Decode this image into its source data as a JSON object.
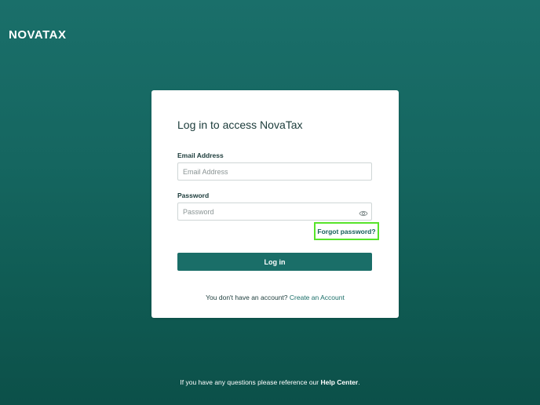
{
  "brand": {
    "logo_text": "NOVATAX"
  },
  "login": {
    "title": "Log in to access NovaTax",
    "email_label": "Email Address",
    "email_placeholder": "Email Address",
    "email_value": "",
    "password_label": "Password",
    "password_placeholder": "Password",
    "password_value": "",
    "forgot_link": "Forgot password?",
    "submit_label": "Log in",
    "signup_prompt": "You don't have an account?",
    "signup_link": "Create an Account"
  },
  "footer": {
    "text_before": "If you have any questions please reference our",
    "help_link": "Help Center",
    "text_after": "."
  },
  "icons": {
    "password_toggle": "eye-icon"
  },
  "colors": {
    "background_top": "#1a6f6a",
    "background_bottom": "#0c5049",
    "primary_button": "#1a6e68",
    "highlight_border": "#57e32a",
    "text_dark": "#1b3b3a"
  }
}
